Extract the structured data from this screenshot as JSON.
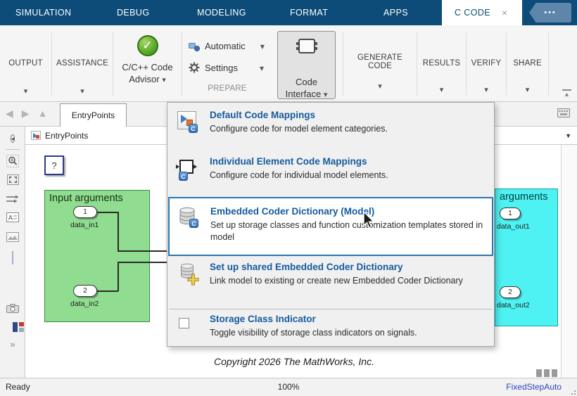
{
  "tab_bar": {
    "tabs": [
      "SIMULATION",
      "DEBUG",
      "MODELING",
      "FORMAT",
      "APPS"
    ],
    "active_tab": {
      "label": "C CODE",
      "close_label": "×"
    },
    "overflow_label": "•••"
  },
  "ribbon": {
    "output": {
      "label": "OUTPUT"
    },
    "assistance": {
      "label": "ASSISTANCE"
    },
    "code_advisor": {
      "icon": "green-check-icon",
      "line1": "C/C++ Code",
      "line2": "Advisor"
    },
    "prepare": {
      "automatic_label": "Automatic",
      "settings_label": "Settings",
      "group_label": "PREPARE"
    },
    "code_interface": {
      "icon": "code-interface-chip-icon",
      "line1": "Code",
      "line2": "Interface"
    },
    "generate_code": {
      "line1": "GENERATE",
      "line2": "CODE"
    },
    "results": {
      "label": "RESULTS"
    },
    "verify": {
      "label": "VERIFY"
    },
    "share": {
      "label": "SHARE"
    }
  },
  "nav_bar": {
    "document_tab": "EntryPoints"
  },
  "breadcrumb": {
    "model_name": "EntryPoints"
  },
  "menu": {
    "items": [
      {
        "icon": "default-code-mappings-icon",
        "title": "Default Code Mappings",
        "description": "Configure code for model element categories.",
        "highlighted": false
      },
      {
        "icon": "individual-element-code-mappings-icon",
        "title": "Individual Element Code Mappings",
        "description": "Configure code for individual model elements.",
        "highlighted": false
      },
      {
        "icon": "coder-dictionary-icon",
        "title": "Embedded Coder Dictionary (Model)",
        "description": "Set up storage classes and function customization templates stored in model",
        "highlighted": true
      },
      {
        "icon": "shared-coder-dictionary-icon",
        "title": "Set up shared Embedded Coder Dictionary",
        "description": "Link model to existing or create new Embedded Coder Dictionary",
        "highlighted": false
      },
      {
        "icon": "checkbox",
        "title": "Storage Class Indicator",
        "description": "Toggle visibility of storage class indicators on signals.",
        "checked": false,
        "highlighted": false
      }
    ]
  },
  "canvas": {
    "unknown_block_label": "?",
    "input_group": {
      "title": "Input arguments",
      "ports": [
        {
          "number": "1",
          "name": "data_in1"
        },
        {
          "number": "2",
          "name": "data_in2"
        }
      ]
    },
    "output_group": {
      "title": "arguments",
      "ports": [
        {
          "number": "1",
          "name": "data_out1"
        },
        {
          "number": "2",
          "name": "data_out2"
        }
      ]
    },
    "copyright": "Copyright 2026 The MathWorks, Inc."
  },
  "status_bar": {
    "left": "Ready",
    "center": "100%",
    "right": "FixedStepAuto"
  },
  "colors": {
    "topbar_blue": "#0d4c78",
    "overflow_button_blue": "#5d86aa",
    "menu_title_blue": "#155a9e",
    "highlight_border_blue": "#2377b8",
    "input_group_green": "#90dc90",
    "output_group_cyan": "#4ef2f2",
    "status_link_blue": "#2f43c0"
  }
}
